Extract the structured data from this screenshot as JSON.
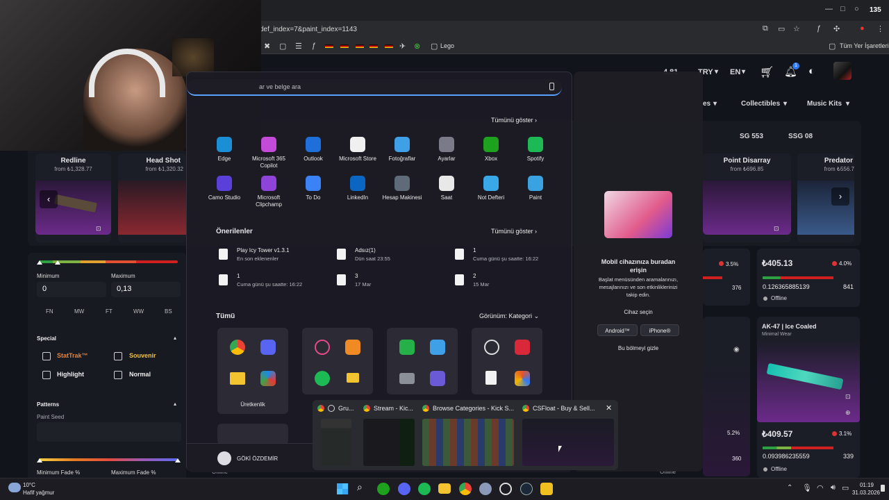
{
  "browser": {
    "url_fragment": "def_index=7&paint_index=1143",
    "tab_count": "135",
    "bookmark_folder": "Lego",
    "bookmarks_all": "Tüm Yer İşaretleri"
  },
  "site": {
    "price_partial": "4,81",
    "currency": "TRY",
    "language": "EN",
    "notif_badge": "1",
    "nav": [
      "es",
      "Collectibles",
      "Music Kits"
    ],
    "tabs": [
      "SG 553",
      "SSG 08"
    ],
    "carousel": [
      {
        "name": "Redline",
        "price": "from ₺1,328.77"
      },
      {
        "name": "Head Shot",
        "price": "from ₺1,320.32"
      },
      {
        "name": "Point Disarray",
        "price": "from ₺696.85"
      },
      {
        "name": "Predator",
        "price": "from ₺556.7"
      }
    ],
    "filters": {
      "min_label": "Minimum",
      "max_label": "Maximum",
      "min_value": "0",
      "max_value": "0,13",
      "wear": [
        "FN",
        "MW",
        "FT",
        "WW",
        "BS"
      ],
      "special_title": "Special",
      "special": [
        "StatTrak™",
        "Souvenir",
        "Highlight",
        "Normal"
      ],
      "patterns_title": "Patterns",
      "paint_seed": "Paint Seed",
      "min_fade": "Minimum Fade %",
      "max_fade": "Maximum Fade %"
    },
    "listings": [
      {
        "pct": "3.5%"
      },
      {
        "price": "₺405.13",
        "pct": "4.0%",
        "float": "0.126365885139",
        "seed": "841",
        "left_seed": "376",
        "status": "Offline"
      },
      {
        "name": "AK-47 | Ice Coaled",
        "wear": "Minimal Wear",
        "price": "₺409.57",
        "pct": "3.1%",
        "float": "0.093986235559",
        "seed": "339",
        "left_pct": "5.2%",
        "left_seed": "360",
        "status": "Offline"
      }
    ],
    "bottom_status": [
      "Offline",
      "Offline",
      "Offline"
    ]
  },
  "start_menu": {
    "search_placeholder": "ar ve belge ara",
    "pinned_show_all": "Tümünü göster",
    "pinned": [
      {
        "label": "Edge",
        "color": "#1b8fd6"
      },
      {
        "label": "Microsoft 365 Copilot",
        "color": "#c44bd8"
      },
      {
        "label": "Outlook",
        "color": "#1e6fd9"
      },
      {
        "label": "Microsoft Store",
        "color": "#f0f0f0"
      },
      {
        "label": "Fotoğraflar",
        "color": "#3fa0e8"
      },
      {
        "label": "Ayarlar",
        "color": "#7a7a88"
      },
      {
        "label": "Xbox",
        "color": "#1ea11e"
      },
      {
        "label": "Spotify",
        "color": "#1db954"
      },
      {
        "label": "Camo Studio",
        "color": "#5a3fd8"
      },
      {
        "label": "Microsoft Clipchamp",
        "color": "#8e44d8"
      },
      {
        "label": "To Do",
        "color": "#3b82f6"
      },
      {
        "label": "LinkedIn",
        "color": "#0a66c2"
      },
      {
        "label": "Hesap Makinesi",
        "color": "#5f6b78"
      },
      {
        "label": "Saat",
        "color": "#e8e8e8"
      },
      {
        "label": "Not Defteri",
        "color": "#38a8e6"
      },
      {
        "label": "Paint",
        "color": "#3aa2e0"
      }
    ],
    "recommended_title": "Önerilenler",
    "recommended_show_all": "Tümünü göster",
    "recommended": [
      {
        "title": "Play Icy Tower v1.3.1",
        "sub": "En son eklenenler"
      },
      {
        "title": "Adsız(1)",
        "sub": "Dün saat 23:55"
      },
      {
        "title": "1",
        "sub": "Cuma günü şu saatte: 16:22"
      },
      {
        "title": "1",
        "sub": "Cuma günü şu saatte: 16:22"
      },
      {
        "title": "3",
        "sub": "17 Mar"
      },
      {
        "title": "2",
        "sub": "15 Mar"
      }
    ],
    "all_title": "Tümü",
    "view_label": "Görünüm: Kategori",
    "group_label": "Üretkenlik",
    "user_name": "GÖKİ ÖZDEMİR"
  },
  "phone_panel": {
    "title": "Mobil cihazınıza buradan erişin",
    "desc": "Başlat menüsünden aramalarınızı, mesajlarınızı ve son etkinliklerinizi takip edin.",
    "device_label": "Cihaz seçin",
    "android": "Android™",
    "iphone": "iPhone®",
    "hide": "Bu bölmeyi gizle"
  },
  "thumbnails": [
    {
      "title": "Gru..."
    },
    {
      "title": "Stream - Kic..."
    },
    {
      "title": "Browse Categories - Kick S..."
    },
    {
      "title": "CSFloat - Buy & Sell..."
    }
  ],
  "taskbar": {
    "temp": "10°C",
    "weather": "Hafif yağmur",
    "time": "01:19",
    "date": "31.03.2026"
  }
}
